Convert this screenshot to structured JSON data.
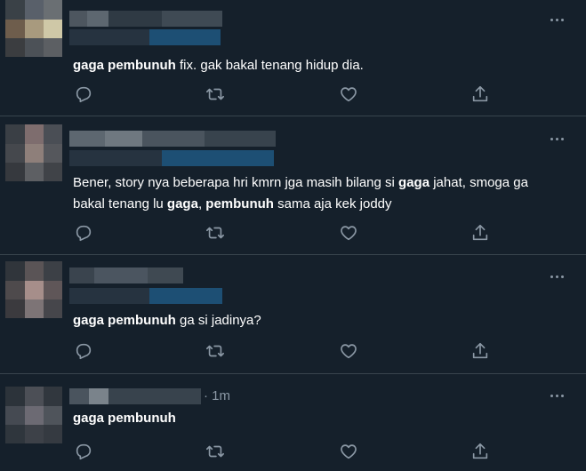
{
  "tweets": [
    {
      "text_parts": [
        {
          "t": "gaga pembunuh",
          "bold": true
        },
        {
          "t": " fix. gak bakal tenang hidup dia.",
          "bold": false
        }
      ]
    },
    {
      "text_line1_parts": [
        {
          "t": "Bener, story nya beberapa hri kmrn jga masih bilang si ",
          "bold": false
        },
        {
          "t": "gaga",
          "bold": true
        },
        {
          "t": " jahat, smoga ga",
          "bold": false
        }
      ],
      "text_line2_parts": [
        {
          "t": "bakal tenang lu ",
          "bold": false
        },
        {
          "t": "gaga",
          "bold": true
        },
        {
          "t": ", ",
          "bold": false
        },
        {
          "t": "pembunuh",
          "bold": true
        },
        {
          "t": " sama aja kek joddy",
          "bold": false
        }
      ]
    },
    {
      "text_parts": [
        {
          "t": "gaga pembunuh",
          "bold": true
        },
        {
          "t": " ga si jadinya?",
          "bold": false
        }
      ]
    },
    {
      "time": "· 1m",
      "text_parts": [
        {
          "t": "gaga pembunuh",
          "bold": true
        }
      ]
    }
  ],
  "icons": {
    "reply": "reply-icon",
    "retweet": "retweet-icon",
    "like": "like-icon",
    "share": "share-icon",
    "more": "more-icon"
  },
  "colors": {
    "background": "#15202b",
    "divider": "#38444d",
    "muted": "#8b98a5",
    "text": "#ffffff",
    "blur_blue": "#1d4f74"
  }
}
